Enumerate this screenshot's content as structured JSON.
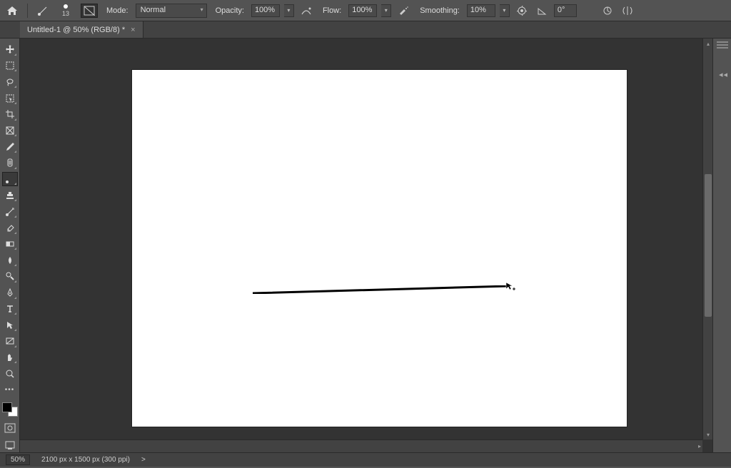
{
  "options": {
    "brush_size": "13",
    "mode_label": "Mode:",
    "mode_value": "Normal",
    "opacity_label": "Opacity:",
    "opacity_value": "100%",
    "flow_label": "Flow:",
    "flow_value": "100%",
    "smoothing_label": "Smoothing:",
    "smoothing_value": "10%",
    "angle_value": "0°"
  },
  "tab": {
    "title": "Untitled-1 @ 50% (RGB/8) *",
    "close": "×"
  },
  "tools": [
    {
      "name": "move-tool"
    },
    {
      "name": "marquee-tool"
    },
    {
      "name": "lasso-tool"
    },
    {
      "name": "object-selection-tool"
    },
    {
      "name": "crop-tool"
    },
    {
      "name": "frame-tool"
    },
    {
      "name": "eyedropper-tool"
    },
    {
      "name": "healing-brush-tool"
    },
    {
      "name": "brush-tool",
      "active": true
    },
    {
      "name": "clone-stamp-tool"
    },
    {
      "name": "history-brush-tool"
    },
    {
      "name": "eraser-tool"
    },
    {
      "name": "gradient-tool"
    },
    {
      "name": "blur-tool"
    },
    {
      "name": "dodge-tool"
    },
    {
      "name": "pen-tool"
    },
    {
      "name": "type-tool"
    },
    {
      "name": "path-selection-tool"
    },
    {
      "name": "rectangle-tool"
    },
    {
      "name": "hand-tool"
    },
    {
      "name": "zoom-tool"
    },
    {
      "name": "edit-toolbar"
    }
  ],
  "status": {
    "zoom": "50%",
    "doc_dims": "2100 px x 1500 px (300 ppi)",
    "arrow": ">"
  }
}
